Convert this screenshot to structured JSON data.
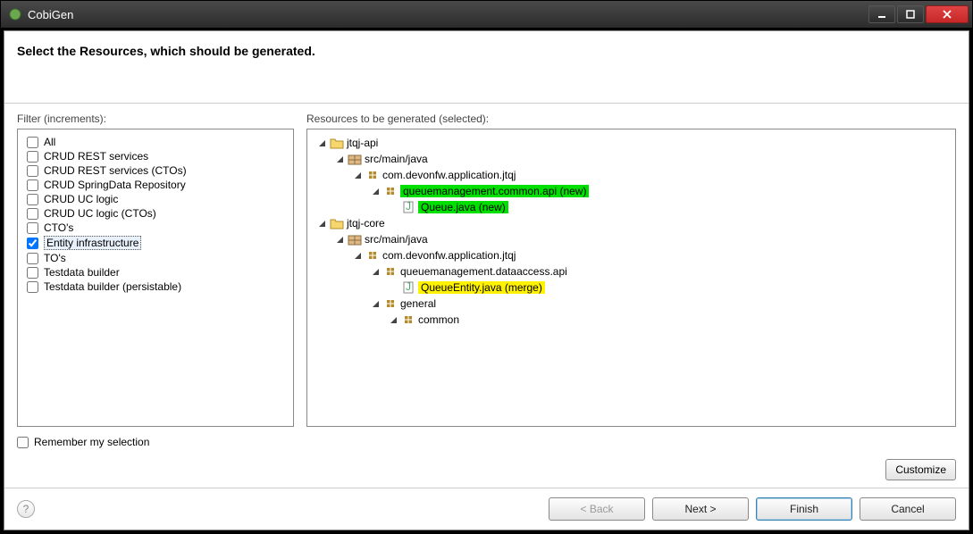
{
  "window": {
    "title": "CobiGen"
  },
  "header": {
    "title": "Select the Resources, which should be generated."
  },
  "filter": {
    "label": "Filter (increments):",
    "items": [
      {
        "label": "All",
        "checked": false
      },
      {
        "label": "CRUD REST services",
        "checked": false
      },
      {
        "label": "CRUD REST services (CTOs)",
        "checked": false
      },
      {
        "label": "CRUD SpringData Repository",
        "checked": false
      },
      {
        "label": "CRUD UC logic",
        "checked": false
      },
      {
        "label": "CRUD UC logic (CTOs)",
        "checked": false
      },
      {
        "label": "CTO's",
        "checked": false
      },
      {
        "label": "Entity infrastructure",
        "checked": true,
        "selected": true
      },
      {
        "label": "TO's",
        "checked": false
      },
      {
        "label": "Testdata builder",
        "checked": false
      },
      {
        "label": "Testdata builder (persistable)",
        "checked": false
      }
    ]
  },
  "resources": {
    "label": "Resources to be generated (selected):",
    "tree": [
      {
        "depth": 0,
        "icon": "project-icon",
        "label": "jtqj-api"
      },
      {
        "depth": 1,
        "icon": "package-folder-icon",
        "label": "src/main/java"
      },
      {
        "depth": 2,
        "icon": "package-icon",
        "label": "com.devonfw.application.jtqj"
      },
      {
        "depth": 3,
        "icon": "package-icon",
        "label": "queuemanagement.common.api (new)",
        "highlight": "new"
      },
      {
        "depth": 4,
        "icon": "java-file-icon",
        "label": "Queue.java (new)",
        "highlight": "new",
        "noToggle": true
      },
      {
        "depth": 0,
        "icon": "project-icon",
        "label": "jtqj-core"
      },
      {
        "depth": 1,
        "icon": "package-folder-icon",
        "label": "src/main/java"
      },
      {
        "depth": 2,
        "icon": "package-icon",
        "label": "com.devonfw.application.jtqj"
      },
      {
        "depth": 3,
        "icon": "package-icon",
        "label": "queuemanagement.dataaccess.api"
      },
      {
        "depth": 4,
        "icon": "java-file-icon",
        "label": "QueueEntity.java (merge)",
        "highlight": "merge",
        "noToggle": true
      },
      {
        "depth": 3,
        "icon": "package-icon",
        "label": "general"
      },
      {
        "depth": 4,
        "icon": "package-icon",
        "label": "common"
      }
    ]
  },
  "remember": {
    "label": "Remember my selection",
    "checked": false
  },
  "buttons": {
    "customize": "Customize",
    "back": "< Back",
    "next": "Next >",
    "finish": "Finish",
    "cancel": "Cancel"
  }
}
